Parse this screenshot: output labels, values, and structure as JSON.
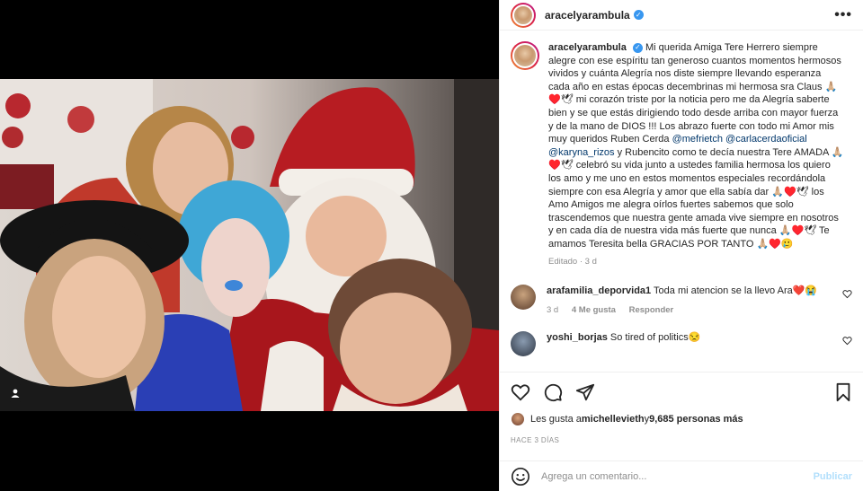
{
  "post": {
    "username": "aracelyarambula",
    "more_icon": "more-horizontal-icon"
  },
  "caption": {
    "username": "aracelyarambula",
    "text_1": "Mi querida Amiga Tere Herrero siempre alegre con ese espíritu tan generoso cuantos momentos hermosos vividos y cuánta Alegría nos diste siempre llevando esperanza cada año en estas épocas decembrinas mi hermosa sra Claus 🙏🏼♥️🕊 mi corazón triste por la noticia pero me da Alegría saberte bien y se que estás dirigiendo todo desde arriba con mayor fuerza y de la mano de DIOS !!! Los abrazo fuerte con todo mi Amor mis muy queridos Ruben Cerda ",
    "mention_1": "@mefrietch",
    "mention_2": "@carlacerdaoficial",
    "mention_3": "@karyna_rizos",
    "text_2": " y Rubencito como te decía nuestra Tere AMADA 🙏🏼♥️🕊 celebró su vida junto a ustedes familia hermosa los quiero los amo y me uno en estos momentos especiales recordándola siempre con esa Alegría y amor que ella sabía dar 🙏🏼♥️🕊 los Amo Amigos me alegra oírlos fuertes sabemos que solo trascendemos que nuestra gente amada vive siempre en nosotros y en cada día de nuestra vida más fuerte que nunca 🙏🏼♥️🕊 Te amamos Teresita bella GRACIAS POR TANTO 🙏🏼♥️🥲",
    "edited": "Editado · 3 d"
  },
  "comments": [
    {
      "username": "arafamilia_deporvida1",
      "text": "Toda mi atencion se la llevo Ara❤️😭",
      "time": "3 d",
      "likes": "4 Me gusta",
      "reply": "Responder"
    },
    {
      "username": "yoshi_borjas",
      "text": "So tired of politics😒"
    }
  ],
  "likes": {
    "prefix": "Les gusta a ",
    "user": "michellevieth",
    "middle": " y ",
    "count": "9,685 personas más"
  },
  "date": "HACE 3 DÍAS",
  "add_comment": {
    "placeholder": "Agrega un comentario...",
    "post": "Publicar"
  },
  "colors": {
    "verified": "#3897f0",
    "mention": "#00376b",
    "muted": "#8e8e8e",
    "post_disabled": "#b2dffc"
  }
}
